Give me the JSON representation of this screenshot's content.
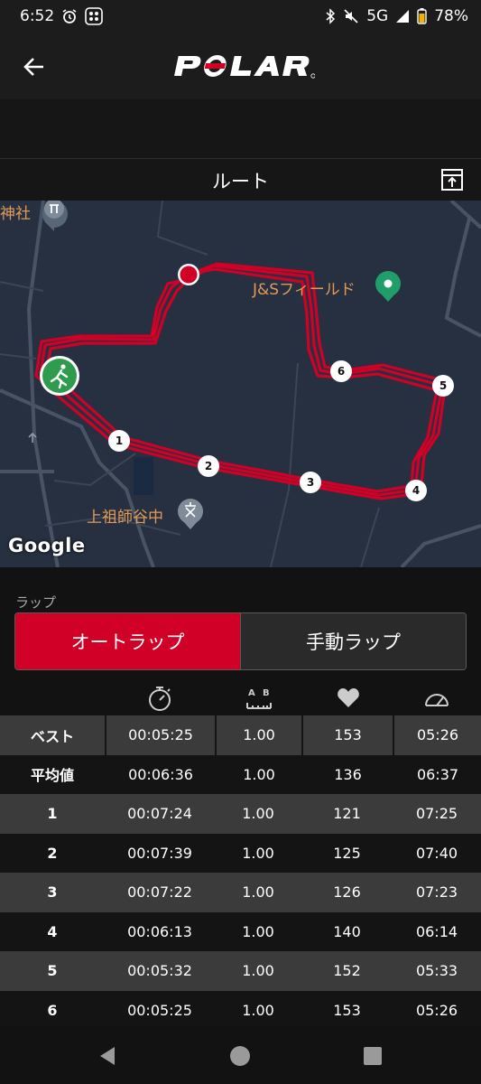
{
  "status_bar": {
    "time": "6:52",
    "network": "5G",
    "battery": "78%"
  },
  "app_bar": {
    "logo_text": "POLAR"
  },
  "route_section": {
    "title": "ルート"
  },
  "map": {
    "labels": {
      "shrine": "神社",
      "field": "J&Sフィールド",
      "school": "上祖師谷中",
      "attribution": "Google"
    },
    "lap_markers": [
      "1",
      "2",
      "3",
      "4",
      "5",
      "6"
    ],
    "route_color": "#d10027",
    "start_marker_color": "#2e9b4d"
  },
  "laps": {
    "caption": "ラップ",
    "auto_lap_label": "オートラップ",
    "manual_lap_label": "手動ラップ",
    "column_icons": [
      "stopwatch-icon",
      "distance-icon",
      "heart-icon",
      "pace-icon"
    ],
    "rows": [
      {
        "label": "ベスト",
        "time": "00:05:25",
        "distance": "1.00",
        "hr": "153",
        "pace": "05:26"
      },
      {
        "label": "平均値",
        "time": "00:06:36",
        "distance": "1.00",
        "hr": "136",
        "pace": "06:37"
      },
      {
        "label": "1",
        "time": "00:07:24",
        "distance": "1.00",
        "hr": "121",
        "pace": "07:25"
      },
      {
        "label": "2",
        "time": "00:07:39",
        "distance": "1.00",
        "hr": "125",
        "pace": "07:40"
      },
      {
        "label": "3",
        "time": "00:07:22",
        "distance": "1.00",
        "hr": "126",
        "pace": "07:23"
      },
      {
        "label": "4",
        "time": "00:06:13",
        "distance": "1.00",
        "hr": "140",
        "pace": "06:14"
      },
      {
        "label": "5",
        "time": "00:05:32",
        "distance": "1.00",
        "hr": "152",
        "pace": "05:33"
      },
      {
        "label": "6",
        "time": "00:05:25",
        "distance": "1.00",
        "hr": "153",
        "pace": "05:26"
      }
    ]
  },
  "accent_color": "#d10027"
}
